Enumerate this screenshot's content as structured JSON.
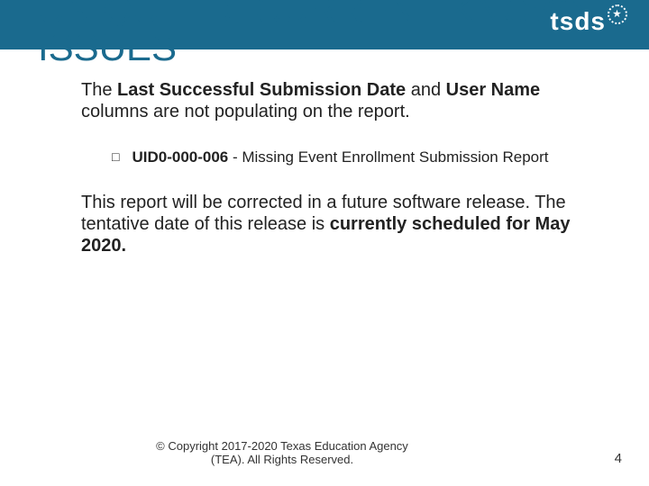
{
  "header": {
    "title": "UNIQUE ID: CURRENT KNOWN ISSUES",
    "logo_text": "tsds"
  },
  "intro": {
    "pre": "The ",
    "b1": "Last Successful Submission Date",
    "mid1": " and ",
    "b2": "User Name",
    "post": " columns are not populating on the report."
  },
  "bullet": {
    "id": "UID0-000-006",
    "text": " - Missing Event Enrollment Submission Report"
  },
  "closing": {
    "l1": "This report will be corrected in a future software release.  The tentative date of this release is ",
    "b1": "currently scheduled for May 2020.",
    "l2": ""
  },
  "footer": {
    "copyright": "© Copyright 2017-2020 Texas Education Agency (TEA). All Rights Reserved.",
    "page": "4"
  }
}
